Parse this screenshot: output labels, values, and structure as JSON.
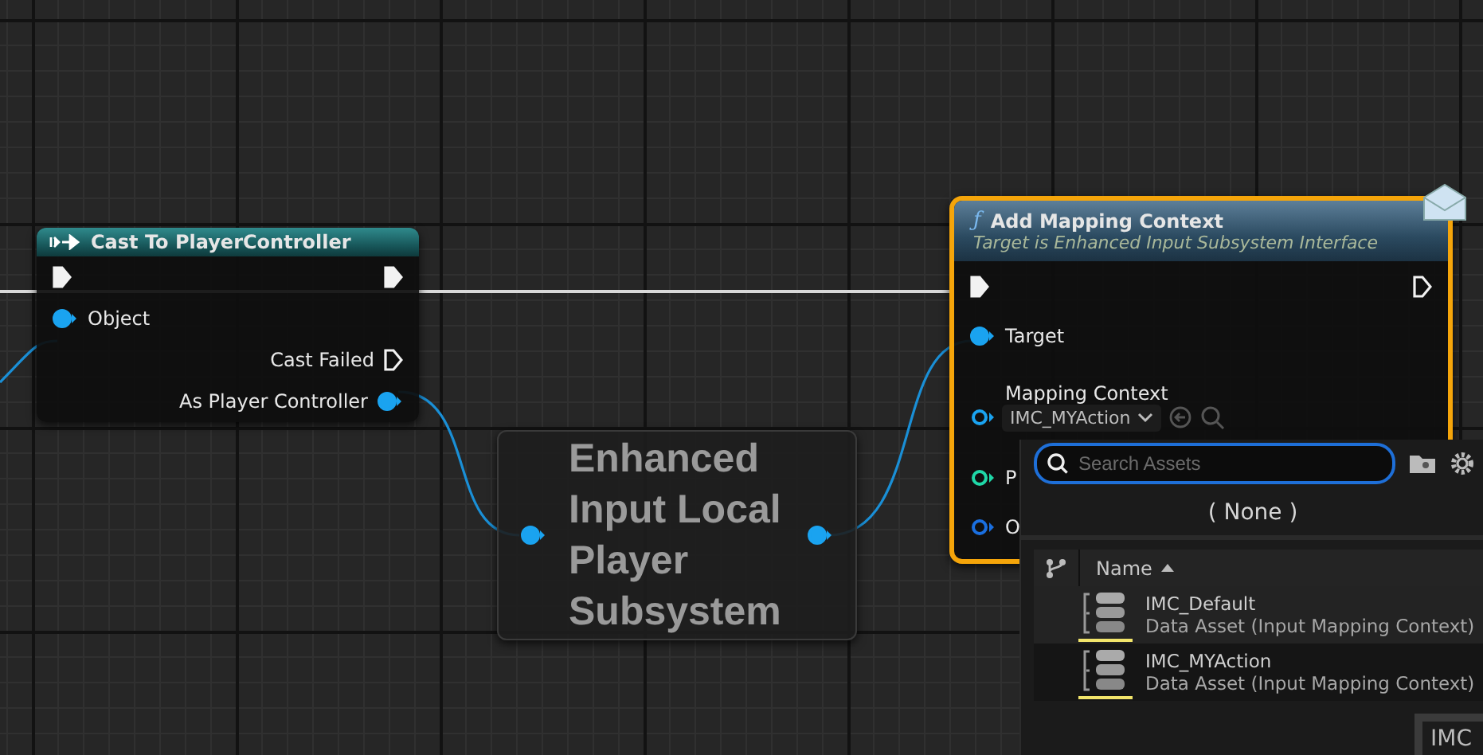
{
  "cast_node": {
    "title": "Cast To PlayerController",
    "inputs": [
      {
        "kind": "object",
        "label": "Object",
        "connected": true
      }
    ],
    "outputs": [
      {
        "kind": "exec",
        "label": "Cast Failed",
        "connected": false
      },
      {
        "kind": "object",
        "label": "As Player Controller",
        "connected": true
      }
    ]
  },
  "subsystem_node": {
    "title": "Enhanced Input Local Player Subsystem"
  },
  "function_node": {
    "icon": "ƒ",
    "title": "Add Mapping Context",
    "subtitle": "Target is Enhanced Input Subsystem Interface",
    "selected": true,
    "pins": [
      {
        "kind": "object",
        "label": "Target",
        "connected": true,
        "color": "#1aa3f0"
      },
      {
        "kind": "asset",
        "label": "Mapping Context",
        "value": "IMC_MYAction",
        "connected": false,
        "color": "#1aa3f0"
      },
      {
        "kind": "plain",
        "label": "P",
        "connected": false,
        "color": "#1fd8a8"
      },
      {
        "kind": "plain",
        "label": "O",
        "connected": false,
        "color": "#1a6fe0"
      }
    ]
  },
  "asset_picker": {
    "search": {
      "placeholder": "Search Assets"
    },
    "none_label": "( None )",
    "column": "Name",
    "assets": [
      {
        "name": "IMC_Default",
        "type": "Data Asset (Input Mapping Context)",
        "selected": false
      },
      {
        "name": "IMC_MYAction",
        "type": "Data Asset (Input Mapping Context)",
        "selected": false
      }
    ]
  },
  "tooltip": {
    "text": "IMC"
  }
}
